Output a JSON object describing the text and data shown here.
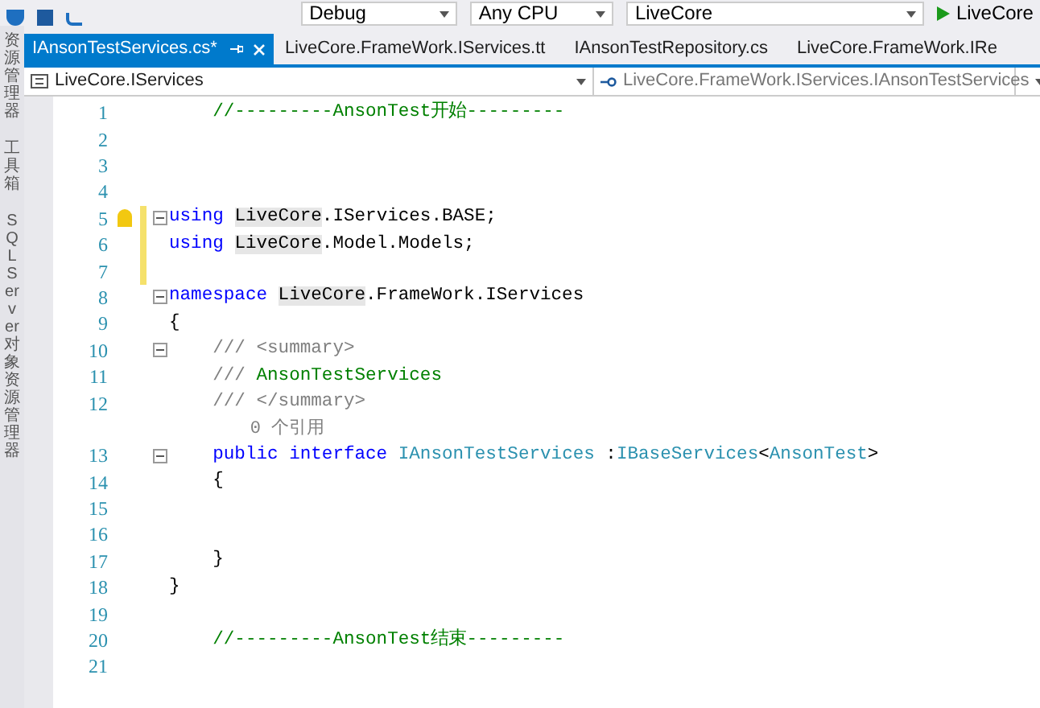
{
  "toolbar": {
    "configuration": "Debug",
    "platform": "Any CPU",
    "project": "LiveCore",
    "run_target": "LiveCore"
  },
  "side_panels": [
    {
      "label": "资源管理器"
    },
    {
      "label": "工具箱"
    },
    {
      "label": "SQL Server 对象资源管理器"
    }
  ],
  "tabs": [
    {
      "label": "IAnsonTestServices.cs*",
      "selected": true
    },
    {
      "label": "LiveCore.FrameWork.IServices.tt",
      "selected": false
    },
    {
      "label": "IAnsonTestRepository.cs",
      "selected": false
    },
    {
      "label": "LiveCore.FrameWork.IRe",
      "selected": false
    }
  ],
  "navigation": {
    "project_scope": "LiveCore.IServices",
    "type_scope": "LiveCore.FrameWork.IServices.IAnsonTestServices"
  },
  "editor": {
    "lines": [
      {
        "number": "1",
        "fold": false,
        "changed": false,
        "lightbulb": false,
        "tokens": [
          {
            "text": "    //---------AnsonTest开始---------",
            "kind": "comment"
          }
        ]
      },
      {
        "number": "2",
        "fold": false,
        "changed": false,
        "lightbulb": false
      },
      {
        "number": "3",
        "fold": false,
        "changed": false,
        "lightbulb": false
      },
      {
        "number": "4",
        "fold": false,
        "changed": false,
        "lightbulb": false
      },
      {
        "number": "5",
        "fold": true,
        "changed": true,
        "lightbulb": true,
        "tokens": [
          {
            "text": "using ",
            "kind": "keyword"
          },
          {
            "text": "LiveCore",
            "kind": "reference"
          },
          {
            "text": ".IServices.BASE;",
            "kind": "plain"
          }
        ]
      },
      {
        "number": "6",
        "fold": false,
        "changed": true,
        "lightbulb": false,
        "tokens": [
          {
            "text": "using ",
            "kind": "keyword"
          },
          {
            "text": "LiveCore",
            "kind": "reference"
          },
          {
            "text": ".Model.Models;",
            "kind": "plain"
          }
        ]
      },
      {
        "number": "7",
        "fold": false,
        "changed": true,
        "lightbulb": false
      },
      {
        "number": "8",
        "fold": true,
        "changed": false,
        "lightbulb": false,
        "tokens": [
          {
            "text": "namespace ",
            "kind": "keyword"
          },
          {
            "text": "LiveCore",
            "kind": "reference"
          },
          {
            "text": ".FrameWork.IServices",
            "kind": "plain"
          }
        ]
      },
      {
        "number": "9",
        "fold": false,
        "changed": false,
        "lightbulb": false,
        "tokens": [
          {
            "text": "{",
            "kind": "plain"
          }
        ]
      },
      {
        "number": "10",
        "fold": true,
        "changed": false,
        "lightbulb": false,
        "tokens": [
          {
            "text": "    /// <summary>",
            "kind": "doc"
          }
        ]
      },
      {
        "number": "11",
        "fold": false,
        "changed": false,
        "lightbulb": false,
        "tokens": [
          {
            "text": "    /// ",
            "kind": "doc"
          },
          {
            "text": "AnsonTestServices",
            "kind": "comment"
          }
        ]
      },
      {
        "number": "12",
        "fold": false,
        "changed": false,
        "lightbulb": false,
        "tokens": [
          {
            "text": "    /// </summary>",
            "kind": "doc"
          }
        ],
        "code_lens": "0 个引用"
      },
      {
        "number": "13",
        "fold": true,
        "changed": false,
        "lightbulb": false,
        "tokens": [
          {
            "text": "    public interface ",
            "kind": "keyword"
          },
          {
            "text": "IAnsonTestServices",
            "kind": "type"
          },
          {
            "text": " :",
            "kind": "plain"
          },
          {
            "text": "IBaseServices",
            "kind": "type"
          },
          {
            "text": "<",
            "kind": "plain"
          },
          {
            "text": "AnsonTest",
            "kind": "type"
          },
          {
            "text": ">",
            "kind": "plain"
          }
        ]
      },
      {
        "number": "14",
        "fold": false,
        "changed": false,
        "lightbulb": false,
        "tokens": [
          {
            "text": "    {",
            "kind": "plain"
          }
        ]
      },
      {
        "number": "15",
        "fold": false,
        "changed": false,
        "lightbulb": false
      },
      {
        "number": "16",
        "fold": false,
        "changed": false,
        "lightbulb": false
      },
      {
        "number": "17",
        "fold": false,
        "changed": false,
        "lightbulb": false,
        "tokens": [
          {
            "text": "    }",
            "kind": "plain"
          }
        ]
      },
      {
        "number": "18",
        "fold": false,
        "changed": false,
        "lightbulb": false,
        "tokens": [
          {
            "text": "}",
            "kind": "plain"
          }
        ]
      },
      {
        "number": "19",
        "fold": false,
        "changed": false,
        "lightbulb": false
      },
      {
        "number": "20",
        "fold": false,
        "changed": false,
        "lightbulb": false,
        "tokens": [
          {
            "text": "    //---------AnsonTest结束---------",
            "kind": "comment"
          }
        ]
      },
      {
        "number": "21",
        "fold": false,
        "changed": false,
        "lightbulb": false
      }
    ]
  }
}
